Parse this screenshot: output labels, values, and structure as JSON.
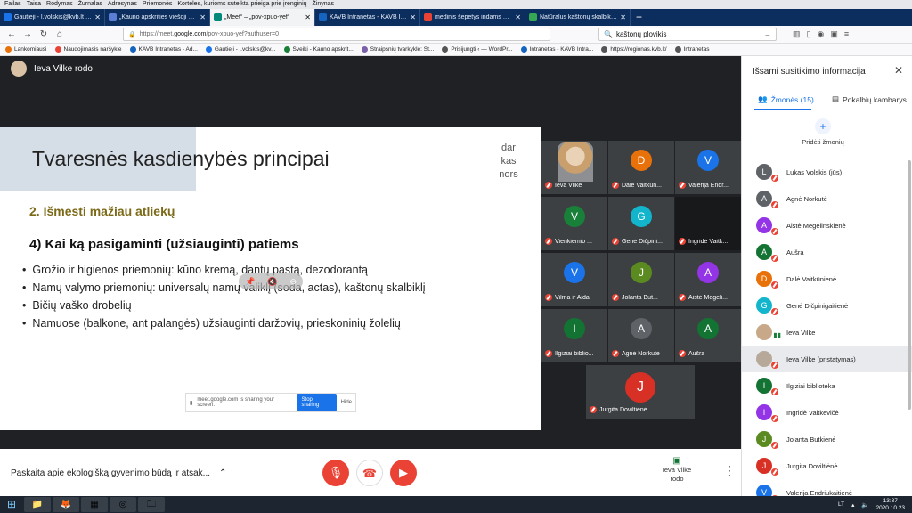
{
  "menubar": [
    "Failas",
    "Taisa",
    "Rodymas",
    "Žurnalas",
    "Adresynas",
    "Priemonės",
    "Korteles, kurioms suteikta prieiga prie įrenginių",
    "Žinynas"
  ],
  "tabs": [
    {
      "title": "Gautieji - l.volskis@kvb.lt - Kau",
      "color": "#1a73e8",
      "active": false
    },
    {
      "title": "„Kauno apskrities viešoji biblio",
      "color": "#5b7fd6",
      "active": false
    },
    {
      "title": "„Meet“ – „pov-xpuo-yef“",
      "color": "#00897b",
      "active": true
    },
    {
      "title": "KAVB Intranetas - KAVB Intrane",
      "color": "#1565c0",
      "active": false
    },
    {
      "title": "medinis šepetys indams – „Goo",
      "color": "#ea4335",
      "active": false
    },
    {
      "title": "Natūralus kaštonų skalbiklis (ki",
      "color": "#34a853",
      "active": false
    }
  ],
  "nav": {
    "back": "←",
    "forward": "→",
    "reload": "↻",
    "home": "⌂",
    "url_prefix": "https://meet.",
    "url_domain": "google.com",
    "url_rest": "/pov-xpuo-yef?authuser=0",
    "search_value": "kaštonų plovikis"
  },
  "bookmarks": [
    "Lankomiausi",
    "Naudojimasis naršykle",
    "KAVB Intranetas - Ad...",
    "Gautieji - l.volskis@kv...",
    "Sveiki - Kauno apskrit...",
    "Straipsnių tvarkyklė: St...",
    "Prisijungti ‹ — WordPr...",
    "Intranetas - KAVB Intra...",
    "https://regionas.kvb.lt/",
    "Intranetas"
  ],
  "presenter": {
    "label": "Ieva Vilke rodo"
  },
  "slide": {
    "title": "Tvaresnės kasdienybės principai",
    "logo_lines": [
      "dar",
      "kas",
      "nors"
    ],
    "subtitle": "2. Išmesti mažiau atliekų",
    "heading": "4) Kai ką pasigaminti (užsiauginti) patiems",
    "bullets": [
      "Grožio ir higienos priemonių: kūno kremą, dantų pastą, dezodorantą",
      "Namų valymo priemonių: universalų namų valiklį (soda, actas), kaštonų skalbiklį",
      "Bičių vaško drobelių",
      "Namuose (balkone, ant palangės) užsiauginti daržovių, prieskoninių žolelių"
    ],
    "sharing_text": "meet.google.com is sharing your screen.",
    "stop_sharing": "Stop sharing",
    "hide": "Hide"
  },
  "grid": [
    {
      "name": "Ieva Vilke",
      "initial": "",
      "color": "#c7a98a",
      "video": true
    },
    {
      "name": "Dalė Vaitkūn...",
      "initial": "D",
      "color": "#e8710a"
    },
    {
      "name": "Valerija Endr...",
      "initial": "V",
      "color": "#1a73e8"
    },
    {
      "name": "Vienkiemio ...",
      "initial": "V",
      "color": "#188038"
    },
    {
      "name": "Genė Dičpini...",
      "initial": "G",
      "color": "#12b5cb"
    },
    {
      "name": "Ingridė Vaitk...",
      "initial": "",
      "color": "#202124",
      "dark": true
    },
    {
      "name": "Vilma ir Aida",
      "initial": "V",
      "color": "#1a73e8"
    },
    {
      "name": "Jolanta But...",
      "initial": "J",
      "color": "#5b8a21"
    },
    {
      "name": "Aistė Megeli...",
      "initial": "A",
      "color": "#9334e6"
    },
    {
      "name": "Ilgiziai biblio...",
      "initial": "I",
      "color": "#137333"
    },
    {
      "name": "Agnė Norkutė",
      "initial": "A",
      "color": "#5f6368"
    },
    {
      "name": "Aušra",
      "initial": "A",
      "color": "#137333"
    },
    {
      "name": "Jurgita Doviltiėnė",
      "initial": "J",
      "color": "#d93025"
    }
  ],
  "controls": {
    "meeting_title": "Paskaita apie ekologišką gyvenimo būdą ir atsak...",
    "chevron": "⌃",
    "presenting_label": "Ieva Vilke rodo",
    "more": "⋮"
  },
  "panel": {
    "title": "Išsami susitikimo informacija",
    "close": "✕",
    "tab_people": "Žmonės (15)",
    "tab_chat": "Pokalbių kambarys",
    "add_people": "Pridėti žmonių",
    "participants": [
      {
        "name": "Lukas Volskis (jūs)",
        "initial": "L",
        "color": "#5f6368"
      },
      {
        "name": "Agnė Norkutė",
        "initial": "A",
        "color": "#5f6368"
      },
      {
        "name": "Aistė Megelinskienė",
        "initial": "A",
        "color": "#9334e6"
      },
      {
        "name": "Aušra",
        "initial": "A",
        "color": "#137333"
      },
      {
        "name": "Dalė Vaitkūnienė",
        "initial": "D",
        "color": "#e8710a"
      },
      {
        "name": "Genė Dičpinigaitienė",
        "initial": "G",
        "color": "#12b5cb"
      },
      {
        "name": "Ieva Vilke",
        "initial": "",
        "color": "#c7a98a",
        "speaking": true
      },
      {
        "name": "Ieva Vilke (pristatymas)",
        "initial": "",
        "color": "#b7a999",
        "highlight": true
      },
      {
        "name": "Ilgiziai biblioteka",
        "initial": "I",
        "color": "#137333"
      },
      {
        "name": "Ingridė Vaitkevičė",
        "initial": "I",
        "color": "#9334e6"
      },
      {
        "name": "Jolanta Butkienė",
        "initial": "J",
        "color": "#5b8a21"
      },
      {
        "name": "Jurgita Doviltiėnė",
        "initial": "J",
        "color": "#d93025"
      },
      {
        "name": "Valerija Endriukaitienė",
        "initial": "V",
        "color": "#1a73e8"
      }
    ]
  },
  "taskbar": {
    "start": "⊞",
    "lang": "LT",
    "time": "13:37",
    "date": "2020.10.23"
  }
}
